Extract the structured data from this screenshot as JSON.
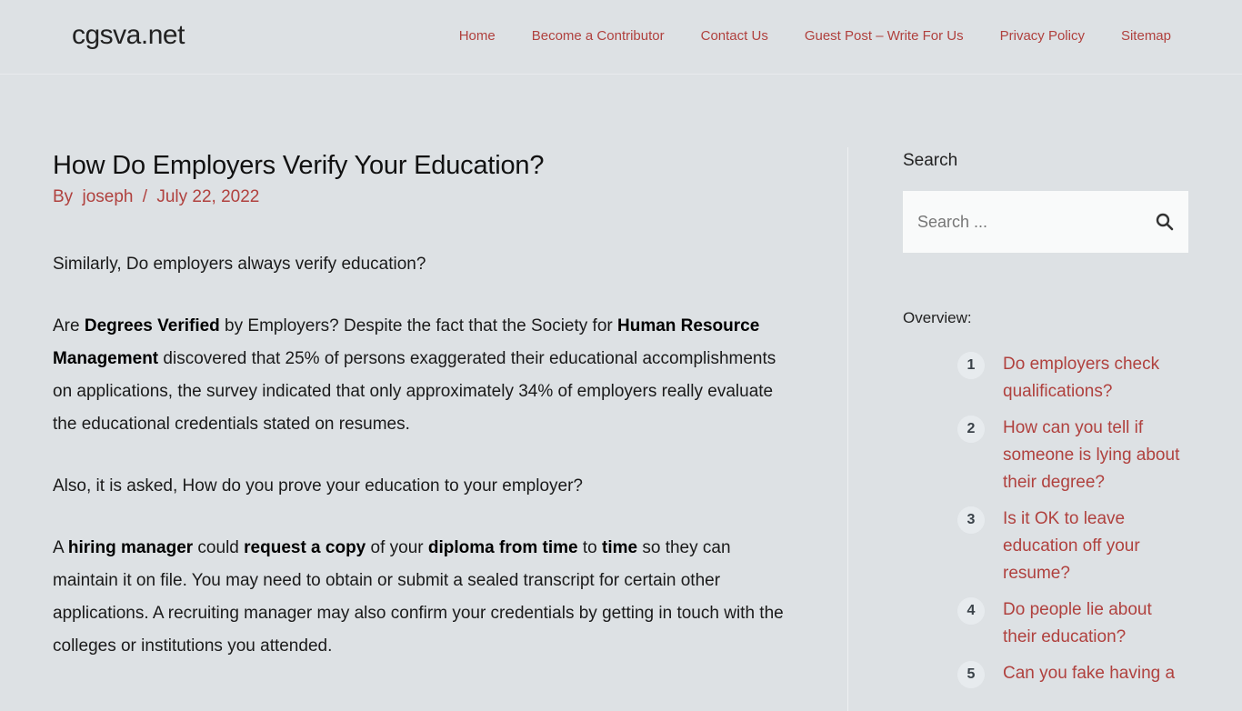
{
  "header": {
    "site_title": "cgsva.net",
    "nav": [
      {
        "label": "Home"
      },
      {
        "label": "Become a Contributor"
      },
      {
        "label": "Contact Us"
      },
      {
        "label": "Guest Post – Write For Us"
      },
      {
        "label": "Privacy Policy"
      },
      {
        "label": "Sitemap"
      }
    ]
  },
  "post": {
    "title": "How Do Employers Verify Your Education?",
    "by_label": "By",
    "author": "joseph",
    "separator": "/",
    "date": "July 22, 2022",
    "paragraphs": [
      {
        "segments": [
          {
            "t": "Similarly, Do employers always verify education?",
            "b": false
          }
        ]
      },
      {
        "segments": [
          {
            "t": "Are ",
            "b": false
          },
          {
            "t": "Degrees Verified",
            "b": true
          },
          {
            "t": " by Employers? Despite the fact that the Society for ",
            "b": false
          },
          {
            "t": "Human Resource Management",
            "b": true
          },
          {
            "t": " discovered that 25% of persons exaggerated their educational accomplishments on applications, the survey indicated that only approximately 34% of employers really evaluate the educational credentials stated on resumes.",
            "b": false
          }
        ]
      },
      {
        "segments": [
          {
            "t": "Also, it is asked, How do you prove your education to your employer?",
            "b": false
          }
        ]
      },
      {
        "segments": [
          {
            "t": "A ",
            "b": false
          },
          {
            "t": "hiring manager",
            "b": true
          },
          {
            "t": " could ",
            "b": false
          },
          {
            "t": "request a copy",
            "b": true
          },
          {
            "t": " of your ",
            "b": false
          },
          {
            "t": "diploma from time",
            "b": true
          },
          {
            "t": " to ",
            "b": false
          },
          {
            "t": "time",
            "b": true
          },
          {
            "t": " so they can maintain it on file. You may need to obtain or submit a sealed transcript for certain other applications. A recruiting manager may also confirm your credentials by getting in touch with the colleges or institutions you attended.",
            "b": false
          }
        ]
      }
    ]
  },
  "sidebar": {
    "search_title": "Search",
    "search_placeholder": "Search ...",
    "search_icon": "search-icon",
    "overview_title": "Overview:",
    "toc": [
      {
        "num": "1",
        "label": "Do employers check qualifications?"
      },
      {
        "num": "2",
        "label": "How can you tell if someone is lying about their degree?"
      },
      {
        "num": "3",
        "label": "Is it OK to leave education off your resume?"
      },
      {
        "num": "4",
        "label": "Do people lie about their education?"
      },
      {
        "num": "5",
        "label": "Can you fake having a"
      }
    ]
  },
  "colors": {
    "accent": "#b0413e",
    "background": "#dde1e4",
    "search_bg": "#f9fafa"
  }
}
